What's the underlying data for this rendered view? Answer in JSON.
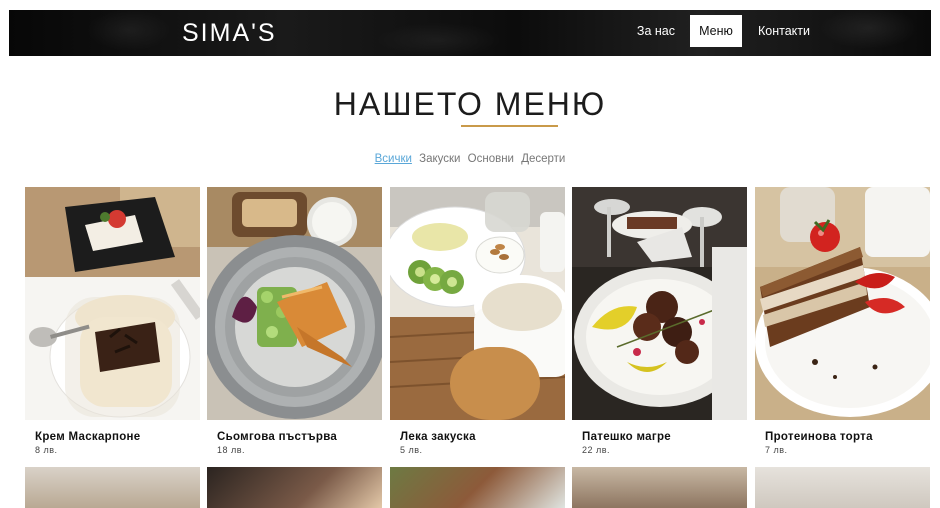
{
  "header": {
    "brand": "SIMA'S",
    "nav": [
      {
        "label": "За нас"
      },
      {
        "label": "Меню",
        "active": true
      },
      {
        "label": "Контакти"
      }
    ]
  },
  "main": {
    "title": "НАШЕТО МЕНЮ",
    "filters": [
      {
        "label": "Всички",
        "active": true
      },
      {
        "label": "Закуски"
      },
      {
        "label": "Основни"
      },
      {
        "label": "Десерти"
      }
    ],
    "items": [
      {
        "name": "Крем Маскарпоне",
        "price": "8 лв."
      },
      {
        "name": "Сьомгова пъстърва",
        "price": "18 лв."
      },
      {
        "name": "Лека закуска",
        "price": "5 лв."
      },
      {
        "name": "Патешко магре",
        "price": "22 лв."
      },
      {
        "name": "Протеинова торта",
        "price": "7 лв."
      }
    ]
  },
  "colors": {
    "accent_gold": "#c99a4a",
    "filter_active": "#5aa7d8",
    "topbar": "#0c0c0c"
  }
}
